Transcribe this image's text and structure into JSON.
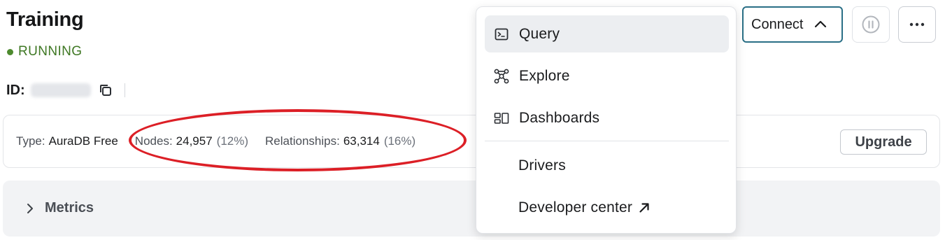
{
  "header": {
    "title": "Training",
    "status": "RUNNING",
    "id_label": "ID:"
  },
  "info": {
    "type_label": "Type:",
    "type_value": "AuraDB Free",
    "nodes_label": "Nodes:",
    "nodes_value": "24,957",
    "nodes_pct": "(12%)",
    "rel_label": "Relationships:",
    "rel_value": "63,314",
    "rel_pct": "(16%)",
    "upgrade_label": "Upgrade"
  },
  "metrics": {
    "label": "Metrics"
  },
  "toolbar": {
    "connect_label": "Connect"
  },
  "connect_menu": {
    "items": [
      {
        "label": "Query",
        "icon": "terminal-icon"
      },
      {
        "label": "Explore",
        "icon": "graph-icon"
      },
      {
        "label": "Dashboards",
        "icon": "dashboard-icon"
      },
      {
        "label": "Drivers"
      },
      {
        "label": "Developer center",
        "icon": "external-link-icon"
      }
    ]
  },
  "colors": {
    "status": "#3f7824",
    "connect_border": "#2a6f86",
    "annotation": "#dc1f26"
  }
}
